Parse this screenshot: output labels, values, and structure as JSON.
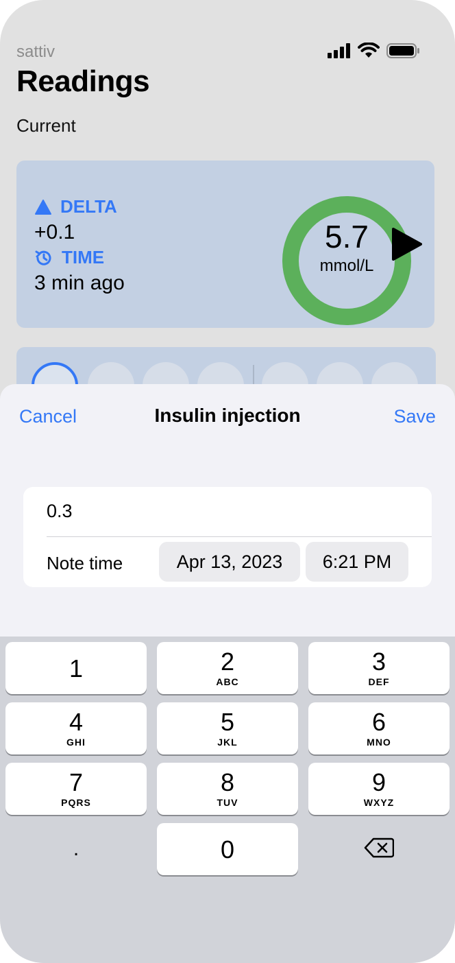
{
  "app": {
    "name": "sattiv",
    "title": "Readings",
    "section": "Current"
  },
  "current": {
    "delta_label": "DELTA",
    "delta_value": "+0.1",
    "time_label": "TIME",
    "time_value": "3 min ago",
    "glucose_value": "5.7",
    "glucose_unit": "mmol/L"
  },
  "colors": {
    "accent": "#3478f6",
    "ring": "#5cb05b",
    "card": "#c3d0e3"
  },
  "sheet": {
    "cancel_label": "Cancel",
    "title": "Insulin injection",
    "save_label": "Save",
    "amount_value": "0.3",
    "note_time_label": "Note time",
    "date_value": "Apr 13, 2023",
    "time_value": "6:21 PM"
  },
  "keyboard": {
    "keys": [
      {
        "digit": "1",
        "letters": ""
      },
      {
        "digit": "2",
        "letters": "ABC"
      },
      {
        "digit": "3",
        "letters": "DEF"
      },
      {
        "digit": "4",
        "letters": "GHI"
      },
      {
        "digit": "5",
        "letters": "JKL"
      },
      {
        "digit": "6",
        "letters": "MNO"
      },
      {
        "digit": "7",
        "letters": "PQRS"
      },
      {
        "digit": "8",
        "letters": "TUV"
      },
      {
        "digit": "9",
        "letters": "WXYZ"
      },
      {
        "digit": "0",
        "letters": ""
      }
    ],
    "decimal_label": "."
  }
}
